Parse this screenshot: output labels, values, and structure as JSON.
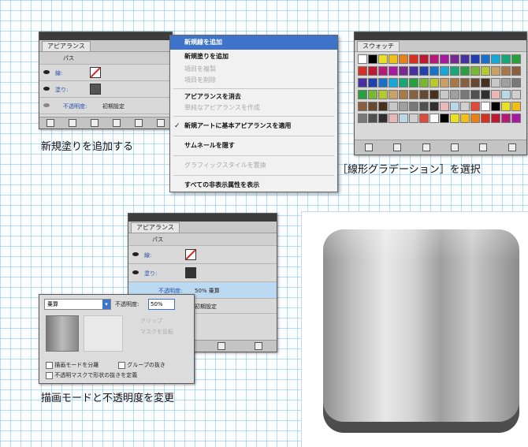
{
  "captions": {
    "step1": "新規塗りを追加する",
    "step2": "［線形グラデーション］を選択",
    "step3": "描画モードと不透明度を変更"
  },
  "appearance_panel": {
    "tab": "アピアランス",
    "object_label": "パス",
    "stroke_label": "線:",
    "fill_label": "塗り:",
    "opacity_label": "不透明度:",
    "opacity_value": "初期設定"
  },
  "context_menu": {
    "items": [
      {
        "label": "新規線を追加",
        "state": "selected"
      },
      {
        "label": "新規塗りを追加",
        "state": "enabled"
      },
      {
        "label": "項目を複製",
        "state": "disabled"
      },
      {
        "label": "項目を削除",
        "state": "disabled"
      },
      {
        "label": "アピアランスを消去",
        "state": "enabled"
      },
      {
        "label": "単純なアピアランスを作成",
        "state": "disabled"
      },
      {
        "label": "新規アートに基本アピアランスを適用",
        "state": "checked"
      },
      {
        "label": "サムネールを隠す",
        "state": "enabled"
      },
      {
        "label": "グラフィックスタイルを置換",
        "state": "disabled"
      },
      {
        "label": "すべての非表示属性を表示",
        "state": "enabled"
      }
    ]
  },
  "swatches_panel": {
    "tab": "スウォッチ",
    "colors": [
      "#ffffff",
      "#000000",
      "#e8e020",
      "#f0c018",
      "#e88018",
      "#d83020",
      "#c01830",
      "#b81878",
      "#a818a0",
      "#782890",
      "#4830a0",
      "#2040b0",
      "#1870c8",
      "#18a8d8",
      "#18a878",
      "#28a040",
      "#78b830",
      "#b8c830",
      "#c8a068",
      "#a87848",
      "#886040",
      "#684830",
      "#483020",
      "#c8c8c8",
      "#a0a0a0",
      "#787878",
      "#505050",
      "#303030",
      "#e8b8b8",
      "#b8d8e8",
      "#d0d0d0",
      "#e04838"
    ]
  },
  "transparency_panel": {
    "blend_mode": "乗算",
    "opacity_label": "不透明度:",
    "opacity_value": "50%",
    "clip_label": "クリップ",
    "invert_label": "マスクを反転",
    "isolate_label": "描画モードを分離",
    "knockout_label": "グループの抜き",
    "shape_label": "不透明マスクで形状の抜きを定義"
  },
  "appearance_panel_2": {
    "tab": "アピアランス",
    "object_label": "パス",
    "stroke_label": "線:",
    "fill_label": "塗り:",
    "opacity_label": "不透明度:",
    "opacity_value": "50% 乗算",
    "opacity_default": "初期設定"
  },
  "colors": {
    "grid": "#78c3eb",
    "panel": "#d9d9d9",
    "menu_highlight": "#3d73c9"
  }
}
